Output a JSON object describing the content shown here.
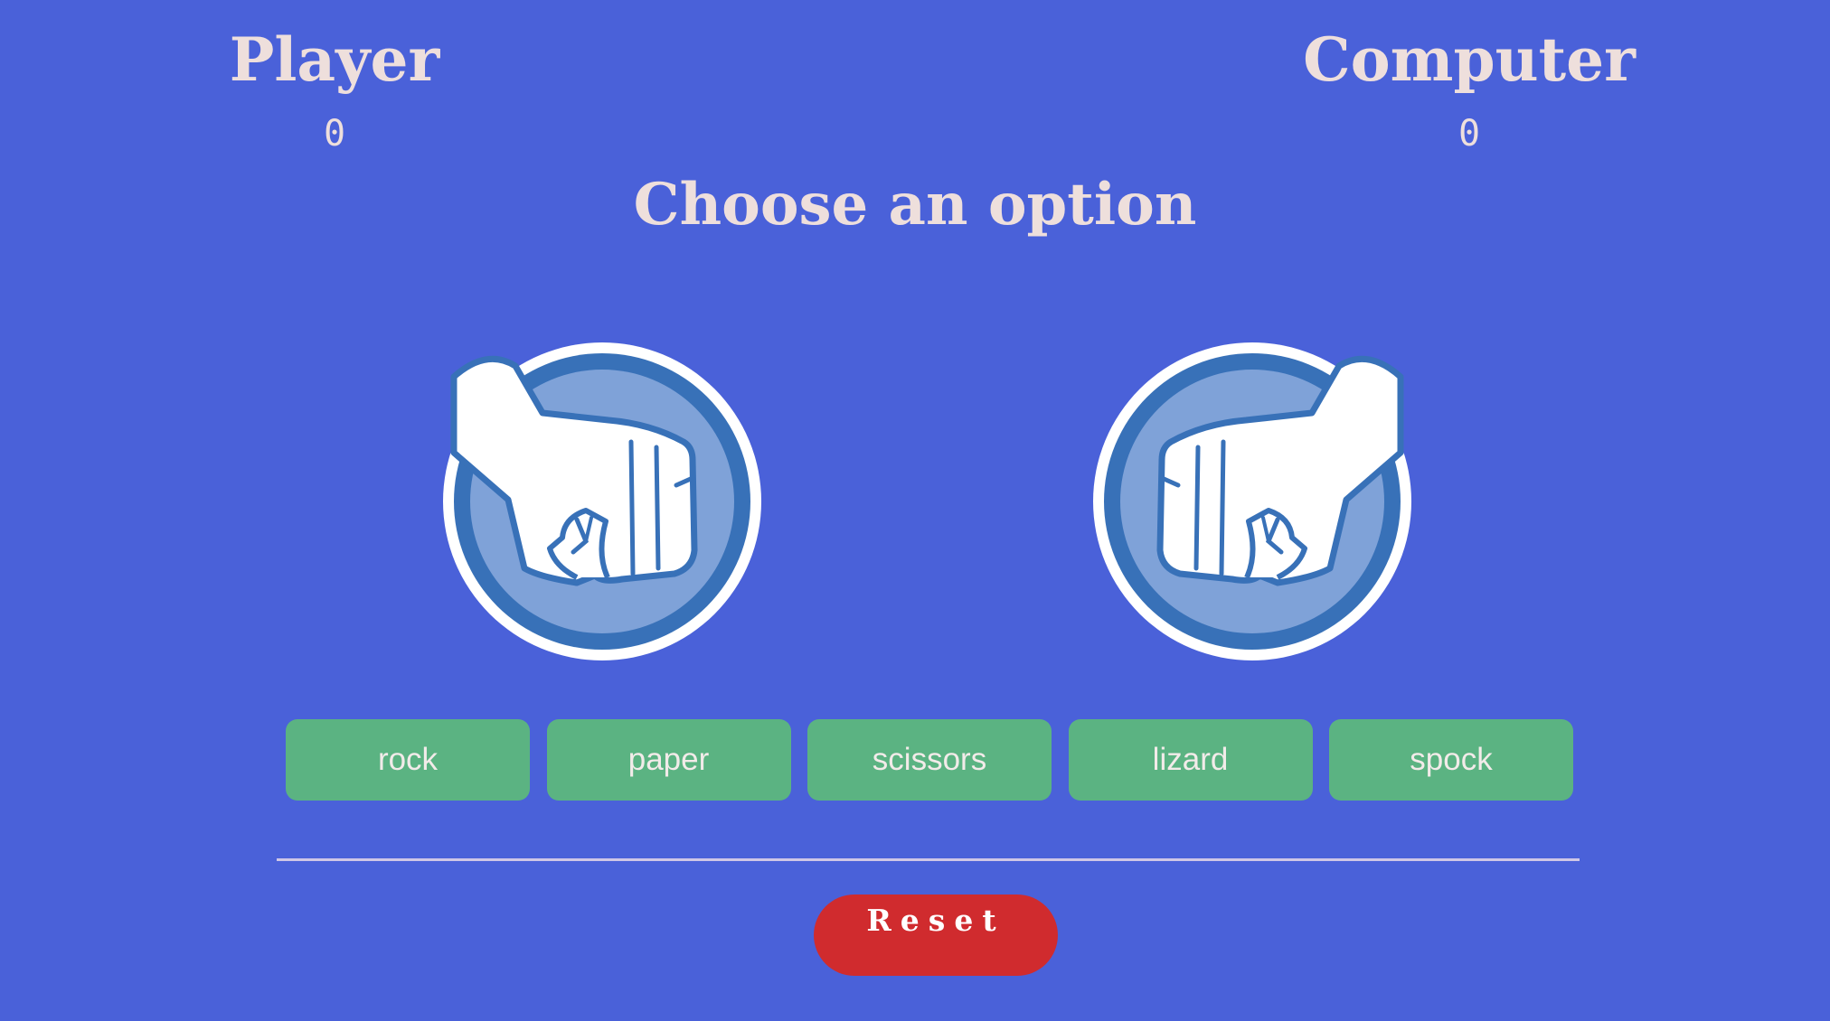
{
  "scoreboard": {
    "player_label": "Player",
    "player_score": "0",
    "computer_label": "Computer",
    "computer_score": "0"
  },
  "prompt": "Choose an option",
  "player_hand": {
    "icon": "rock-fist-icon"
  },
  "computer_hand": {
    "icon": "rock-fist-icon"
  },
  "choices": [
    {
      "label": "rock"
    },
    {
      "label": "paper"
    },
    {
      "label": "scissors"
    },
    {
      "label": "lizard"
    },
    {
      "label": "spock"
    }
  ],
  "reset_label": "Reset",
  "colors": {
    "background": "#4a61d9",
    "text": "#eedfdc",
    "choice_button": "#5bb382",
    "reset_button": "#d02b2e",
    "circle_ring": "#3871b8",
    "circle_fill": "#7fa2d8"
  }
}
